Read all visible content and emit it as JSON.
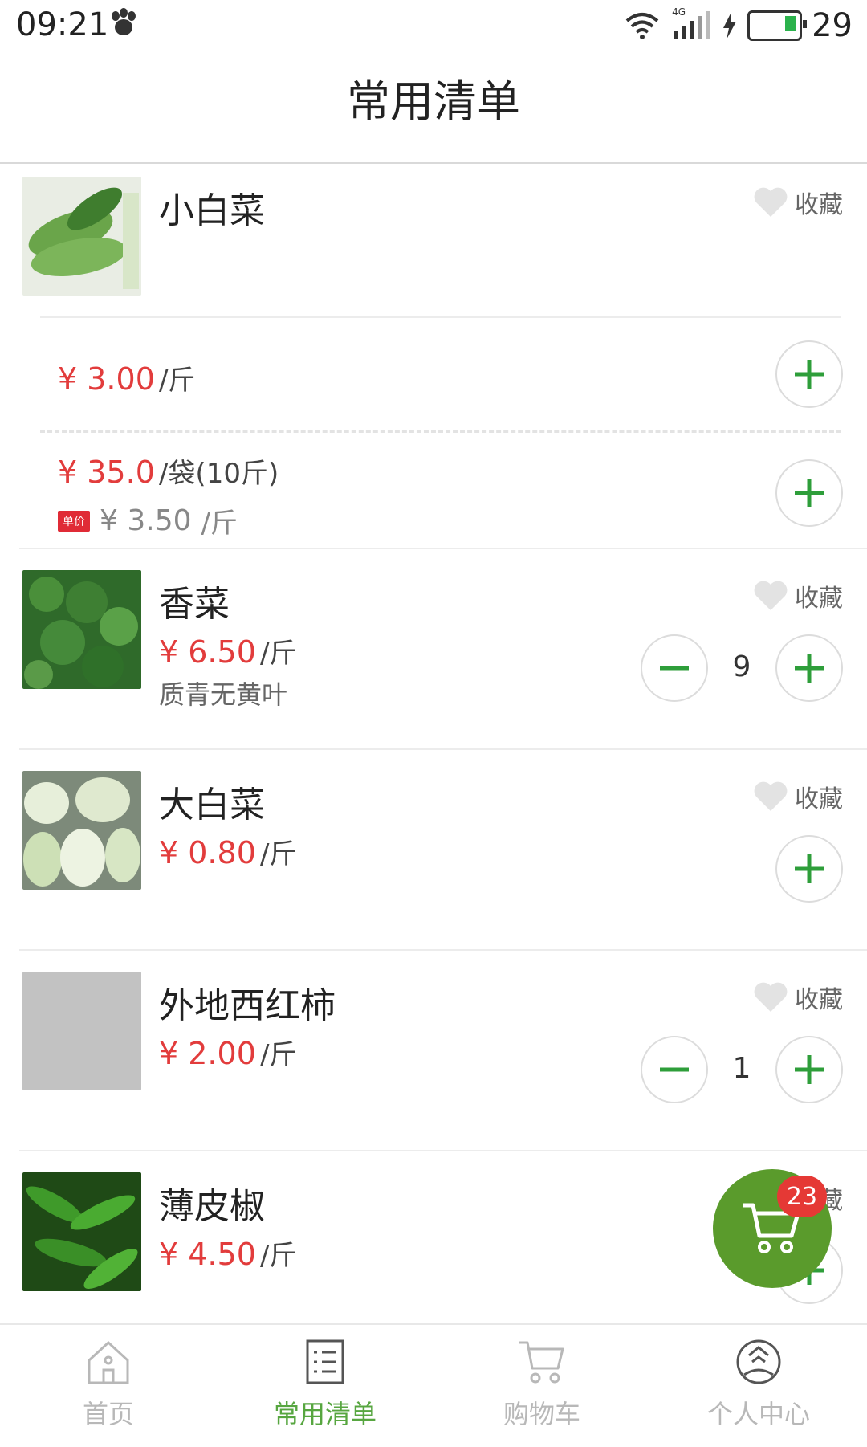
{
  "status_bar": {
    "time": "09:21",
    "network": "4G",
    "battery": "29"
  },
  "header": {
    "title": "常用清单"
  },
  "products": [
    {
      "name": "小白菜",
      "favorite_label": "收藏",
      "offers": [
        {
          "price": "¥ 3.00",
          "unit": "/斤"
        },
        {
          "price": "¥ 35.0",
          "unit": "/袋(10斤)",
          "tag": "单价",
          "unit_price": "¥ 3.50",
          "unit_price_unit": "/斤"
        }
      ]
    },
    {
      "name": "香菜",
      "price": "¥ 6.50",
      "unit": "/斤",
      "desc": "质青无黄叶",
      "favorite_label": "收藏",
      "qty": "9"
    },
    {
      "name": "大白菜",
      "price": "¥ 0.80",
      "unit": "/斤",
      "favorite_label": "收藏"
    },
    {
      "name": "外地西红柿",
      "price": "¥ 2.00",
      "unit": "/斤",
      "favorite_label": "收藏",
      "qty": "1"
    },
    {
      "name": "薄皮椒",
      "price": "¥ 4.50",
      "unit": "/斤",
      "favorite_label": "藏"
    }
  ],
  "cart_fab": {
    "badge": "23"
  },
  "nav": [
    {
      "label": "首页",
      "icon": "home-icon"
    },
    {
      "label": "常用清单",
      "icon": "list-icon",
      "active": true
    },
    {
      "label": "购物车",
      "icon": "cart-icon"
    },
    {
      "label": "个人中心",
      "icon": "profile-icon"
    }
  ],
  "colors": {
    "accent": "#57a640",
    "price": "#e23c3c",
    "fab": "#5a9b2c",
    "badge": "#e53935"
  }
}
